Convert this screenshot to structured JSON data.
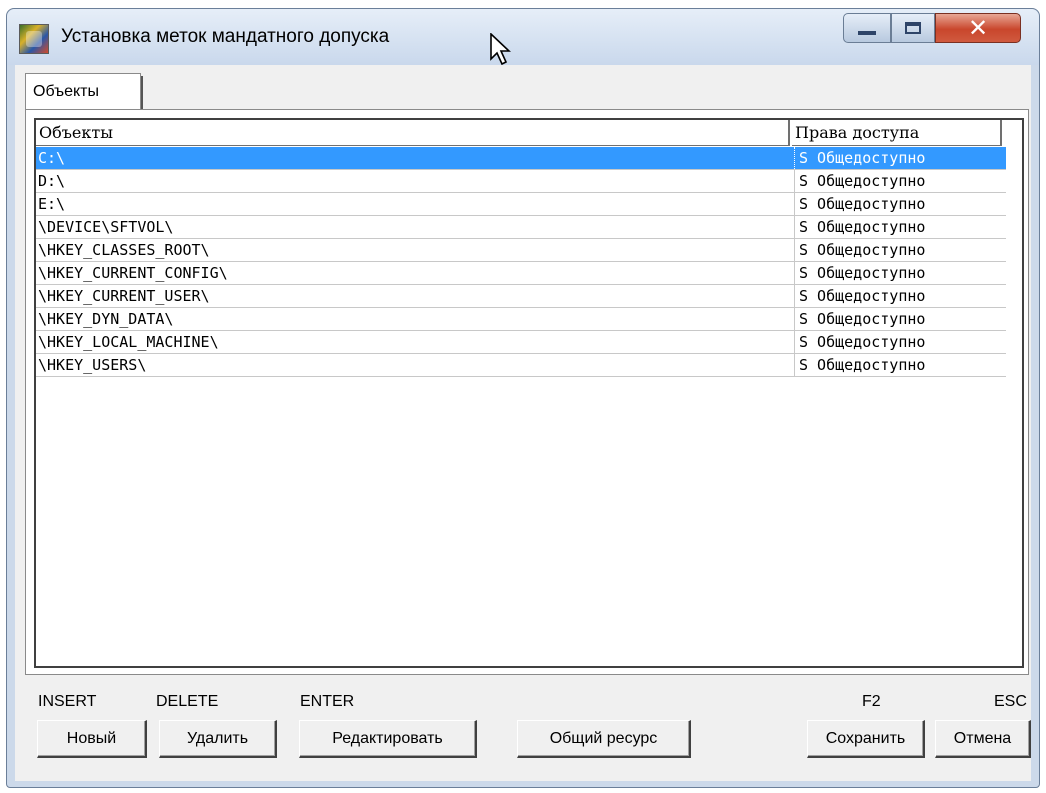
{
  "window": {
    "title": "Установка меток мандатного допуска",
    "controls": {
      "minimize": "minimize",
      "maximize": "maximize",
      "close": "close"
    }
  },
  "tabs": [
    {
      "label": "Объекты",
      "selected": true
    }
  ],
  "list": {
    "columns": [
      "Объекты",
      "Права доступа"
    ],
    "rows": [
      {
        "path": "C:\\",
        "rights": "S Общедоступно",
        "selected": true
      },
      {
        "path": "D:\\",
        "rights": "S Общедоступно",
        "selected": false
      },
      {
        "path": "E:\\",
        "rights": "S Общедоступно",
        "selected": false
      },
      {
        "path": "\\DEVICE\\SFTVOL\\",
        "rights": "S Общедоступно",
        "selected": false
      },
      {
        "path": "\\HKEY_CLASSES_ROOT\\",
        "rights": "S Общедоступно",
        "selected": false
      },
      {
        "path": "\\HKEY_CURRENT_CONFIG\\",
        "rights": "S Общедоступно",
        "selected": false
      },
      {
        "path": "\\HKEY_CURRENT_USER\\",
        "rights": "S Общедоступно",
        "selected": false
      },
      {
        "path": "\\HKEY_DYN_DATA\\",
        "rights": "S Общедоступно",
        "selected": false
      },
      {
        "path": "\\HKEY_LOCAL_MACHINE\\",
        "rights": "S Общедоступно",
        "selected": false
      },
      {
        "path": "\\HKEY_USERS\\",
        "rights": "S Общедоступно",
        "selected": false
      }
    ]
  },
  "shortcuts": {
    "insert": "INSERT",
    "delete": "DELETE",
    "enter": "ENTER",
    "f2": "F2",
    "esc": "ESC"
  },
  "buttons": {
    "new": "Новый",
    "delete": "Удалить",
    "edit": "Редактировать",
    "shared": "Общий ресурс",
    "save": "Сохранить",
    "cancel": "Отмена"
  },
  "colors": {
    "selection": "#3399ff",
    "close_button": "#c9462c",
    "frame": "#ccd9ea"
  }
}
